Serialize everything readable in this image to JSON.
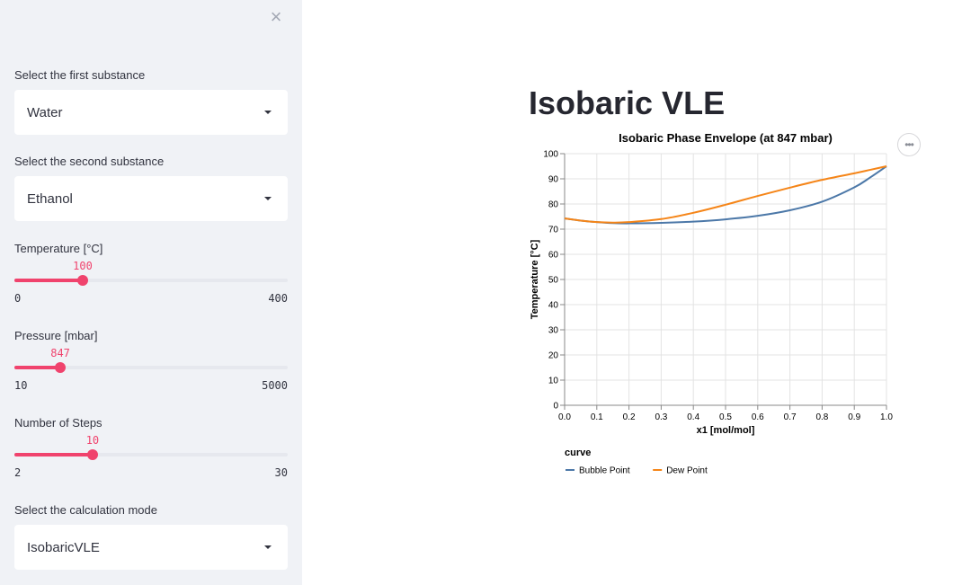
{
  "sidebar": {
    "close_icon": "close-icon",
    "first_substance": {
      "label": "Select the first substance",
      "value": "Water"
    },
    "second_substance": {
      "label": "Select the second substance",
      "value": "Ethanol"
    },
    "temperature": {
      "label": "Temperature [°C]",
      "value": "100",
      "min": "0",
      "max": "400",
      "fraction": 0.25
    },
    "pressure": {
      "label": "Pressure [mbar]",
      "value": "847",
      "min": "10",
      "max": "5000",
      "fraction": 0.168
    },
    "steps": {
      "label": "Number of Steps",
      "value": "10",
      "min": "2",
      "max": "30",
      "fraction": 0.286
    },
    "mode": {
      "label": "Select the calculation mode",
      "value": "IsobaricVLE"
    }
  },
  "main": {
    "title": "Isobaric VLE",
    "menu_icon": "more-horizontal-icon"
  },
  "colors": {
    "accent": "#f0436d",
    "bubble": "#4c78a8",
    "dew": "#f58518",
    "sidebar_bg": "#f0f2f6"
  },
  "chart_data": {
    "type": "line",
    "title": "Isobaric Phase Envelope (at 847 mbar)",
    "xlabel": "x1 [mol/mol]",
    "ylabel": "Temperature [°C]",
    "xlim": [
      0,
      1
    ],
    "ylim": [
      0,
      100
    ],
    "xticks": [
      "0.0",
      "0.1",
      "0.2",
      "0.3",
      "0.4",
      "0.5",
      "0.6",
      "0.7",
      "0.8",
      "0.9",
      "1.0"
    ],
    "yticks": [
      "0",
      "10",
      "20",
      "30",
      "40",
      "50",
      "60",
      "70",
      "80",
      "90",
      "100"
    ],
    "grid": true,
    "legend": {
      "title": "curve",
      "position": "bottom-left"
    },
    "series": [
      {
        "name": "Bubble Point",
        "color": "#4c78a8",
        "x": [
          0,
          0.05,
          0.1,
          0.15,
          0.2,
          0.3,
          0.4,
          0.5,
          0.6,
          0.7,
          0.8,
          0.9,
          0.95,
          1.0
        ],
        "y": [
          74.3,
          73.4,
          72.8,
          72.4,
          72.3,
          72.5,
          73.0,
          73.9,
          75.3,
          77.5,
          80.9,
          86.6,
          90.6,
          95.0
        ]
      },
      {
        "name": "Dew Point",
        "color": "#f58518",
        "x": [
          0,
          0.05,
          0.1,
          0.15,
          0.2,
          0.3,
          0.4,
          0.5,
          0.6,
          0.7,
          0.8,
          0.9,
          0.95,
          1.0
        ],
        "y": [
          74.3,
          73.4,
          72.8,
          72.6,
          72.8,
          74.0,
          76.5,
          79.7,
          83.2,
          86.5,
          89.6,
          92.2,
          93.6,
          95.0
        ]
      }
    ]
  }
}
